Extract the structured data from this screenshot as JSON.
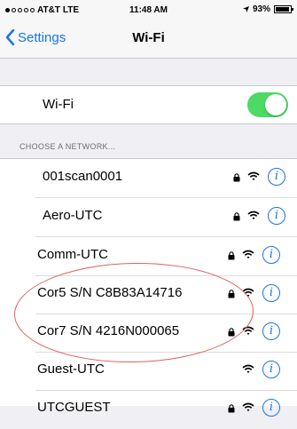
{
  "status_bar": {
    "carrier": "AT&T",
    "network": "LTE",
    "time": "11:48 AM",
    "battery": "93%",
    "battery_fraction": 0.93
  },
  "nav": {
    "back_label": "Settings",
    "title": "Wi-Fi"
  },
  "wifi": {
    "label": "Wi-Fi",
    "enabled": true,
    "toggle_color": "#4cd964"
  },
  "section_header": "CHOOSE A NETWORK...",
  "networks": [
    {
      "name": "001scan0001",
      "secured": true
    },
    {
      "name": "Aero-UTC",
      "secured": true
    },
    {
      "name": "Comm-UTC",
      "secured": true
    },
    {
      "name": "Cor5 S/N C8B83A14716",
      "secured": true
    },
    {
      "name": "Cor7 S/N 4216N000065",
      "secured": true
    },
    {
      "name": "Guest-UTC",
      "secured": false
    },
    {
      "name": "UTCGUEST",
      "secured": true
    }
  ],
  "colors": {
    "accent": "#1a73e8",
    "annotation": "#e06060"
  }
}
